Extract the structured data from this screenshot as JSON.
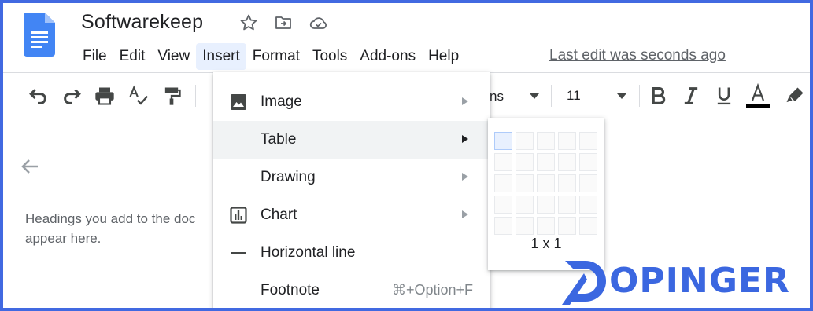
{
  "app": {
    "title": "Softwarekeep",
    "last_edit": "Last edit was seconds ago"
  },
  "header_icons": [
    "star-icon",
    "move-to-folder-icon",
    "cloud-saved-icon"
  ],
  "menubar": {
    "items": [
      "File",
      "Edit",
      "View",
      "Insert",
      "Format",
      "Tools",
      "Add-ons",
      "Help"
    ],
    "active": "Insert"
  },
  "toolbar": {
    "icons": [
      "undo-icon",
      "redo-icon",
      "print-icon",
      "spellcheck-icon",
      "paint-format-icon",
      "bold-icon",
      "italic-icon",
      "underline-icon",
      "text-color-icon",
      "highlight-icon"
    ],
    "font_name_partial": "ns",
    "font_size": "11",
    "text_color": "#000000"
  },
  "outline": {
    "hint": "Headings you add to the doc… appear here.",
    "hint_line1": "Headings you add to the doc",
    "hint_line2": "appear here."
  },
  "insert_menu": {
    "items": [
      {
        "label": "Image",
        "icon": "image-icon",
        "submenu": true,
        "shortcut": ""
      },
      {
        "label": "Table",
        "icon": "",
        "submenu": true,
        "shortcut": "",
        "highlighted": true
      },
      {
        "label": "Drawing",
        "icon": "",
        "submenu": true,
        "shortcut": ""
      },
      {
        "label": "Chart",
        "icon": "chart-icon",
        "submenu": true,
        "shortcut": ""
      },
      {
        "label": "Horizontal line",
        "icon": "horizontal-line-icon",
        "submenu": false,
        "shortcut": ""
      },
      {
        "label": "Footnote",
        "icon": "",
        "submenu": false,
        "shortcut": "⌘+Option+F"
      }
    ]
  },
  "table_picker": {
    "rows": 5,
    "cols": 5,
    "selected_rows": 1,
    "selected_cols": 1,
    "label": "1 x 1"
  },
  "watermark": {
    "text": "OPINGER",
    "brand_color": "#3b67e0"
  },
  "colors": {
    "frame_border": "#4169e1",
    "menu_highlight": "#f1f3f4",
    "active_menu": "#e8f0fe"
  }
}
